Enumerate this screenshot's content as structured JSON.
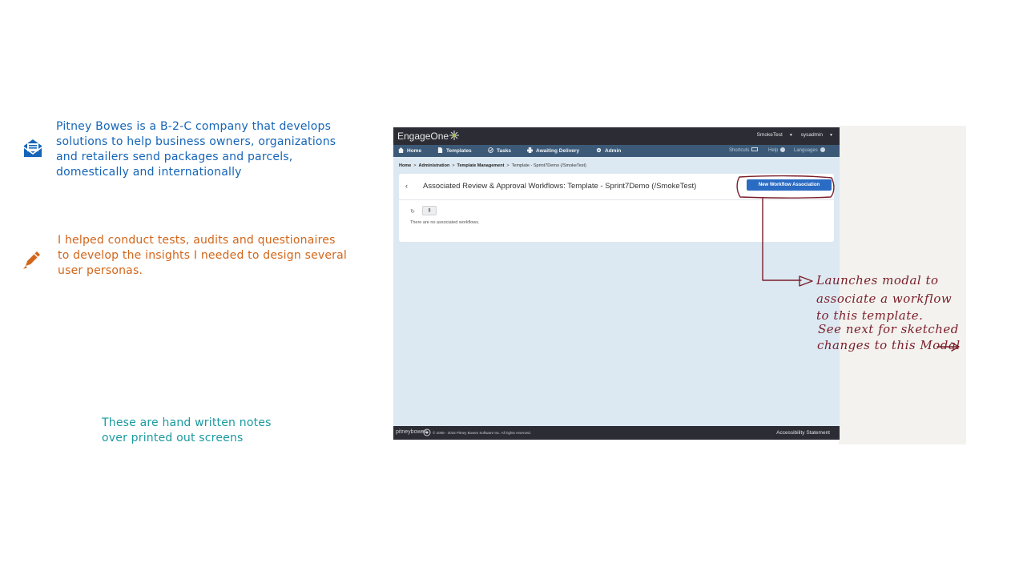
{
  "notes": {
    "company": [
      "Pitney Bowes is a B-2-C company that develops",
      "solutions to help business owners, organizations",
      "and retailers send packages and parcels,",
      "domestically and internationally"
    ],
    "research": [
      "I helped conduct tests, audits and questionaires",
      "to develop the insights I needed to design several",
      "user personas."
    ],
    "caption": [
      "These are hand written notes",
      "over printed out screens"
    ]
  },
  "icons": {
    "company": "envelope-list-icon",
    "research": "pen-icon"
  },
  "app": {
    "brand": "EngageOne",
    "brand_mark": "™",
    "header_user": [
      "SmokeTest",
      "sysadmin"
    ],
    "nav": [
      {
        "label": "Home",
        "icon": "home-icon"
      },
      {
        "label": "Templates",
        "icon": "document-icon"
      },
      {
        "label": "Tasks",
        "icon": "check-icon"
      },
      {
        "label": "Awaiting Delivery",
        "icon": "printer-icon"
      },
      {
        "label": "Admin",
        "icon": "gear-icon"
      }
    ],
    "nav_right": {
      "shortcuts": "Shortcuts",
      "help": "Help",
      "languages": "Languages"
    },
    "breadcrumb": [
      "Home",
      "Administration",
      "Template Management",
      "Template - Sprint7Demo (/SmokeTest)"
    ],
    "page_title": "Associated Review & Approval Workflows: Template - Sprint7Demo (/SmokeTest)",
    "primary_button": "New Workflow Association",
    "back_glyph": "‹",
    "refresh_glyph": "↻",
    "delete_glyph": "▮",
    "empty_message": "There are no associated workflows.",
    "footer": {
      "logo": "pitneybowes",
      "copyright": "© 2008 - 2016 Pitney Bowes Software Inc. All rights reserved.",
      "accessibility": "Accessibility Statement"
    }
  },
  "handwriting": [
    "Launches modal to",
    "associate a workflow",
    "to this template.",
    "See next for sketched",
    "changes to this Modal"
  ],
  "colors": {
    "company_text": "#1565b8",
    "research_text": "#d2661a",
    "caption_text": "#1a9aa0",
    "ink": "#7a1e2a",
    "primary_button": "#2a6bc3",
    "nav_bar": "#3c5a78",
    "top_bar": "#2c2d34"
  }
}
